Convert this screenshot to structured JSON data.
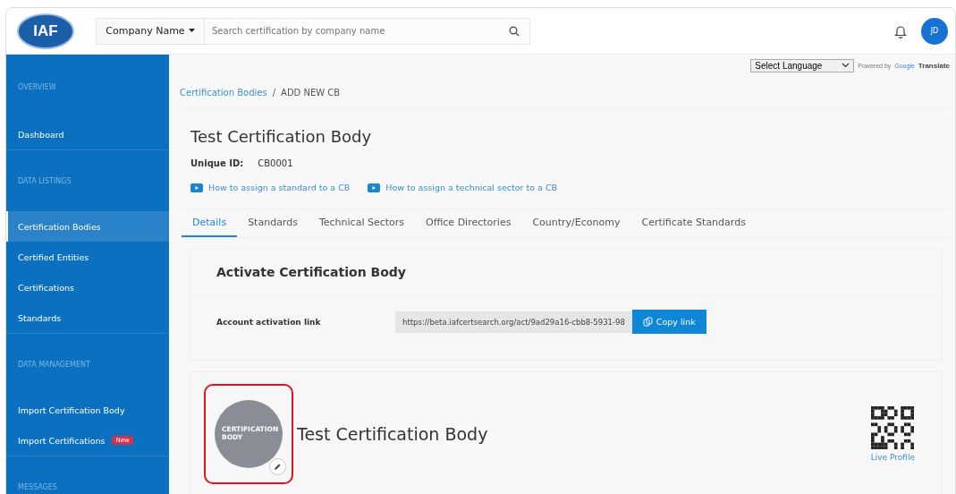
{
  "header": {
    "logo": "IAF",
    "company_dropdown": "Company Name",
    "search": {
      "placeholder": "Search certification by company name"
    },
    "avatar": "JD"
  },
  "sidebar": {
    "items": [
      {
        "kind": "heading",
        "label": "OVERVIEW"
      },
      {
        "kind": "item",
        "label": "Dashboard",
        "selected": false
      },
      {
        "kind": "heading",
        "label": "DATA LISTINGS"
      },
      {
        "kind": "item",
        "label": "Certification Bodies",
        "selected": true
      },
      {
        "kind": "item",
        "label": "Certified Entities",
        "selected": false
      },
      {
        "kind": "item",
        "label": "Certifications",
        "selected": false
      },
      {
        "kind": "item",
        "label": "Standards",
        "selected": false
      },
      {
        "kind": "heading",
        "label": "DATA MANAGEMENT"
      },
      {
        "kind": "item",
        "label": "Import Certification Body",
        "selected": false
      },
      {
        "kind": "item",
        "label": "Import Certifications",
        "selected": false,
        "badge": "New"
      },
      {
        "kind": "heading",
        "label": "MESSAGES"
      }
    ]
  },
  "translate": {
    "select": "Select Language",
    "powered_by": "Powered by",
    "brand": "Google",
    "product": "Translate"
  },
  "breadcrumb": {
    "link": "Certification Bodies",
    "separator": "/",
    "current": "ADD NEW CB"
  },
  "page": {
    "title": "Test Certification Body",
    "unique_id_label": "Unique ID:",
    "unique_id": "CB0001",
    "help_links": [
      "How to assign a standard to a CB",
      "How to assign a technical sector to a CB"
    ]
  },
  "tabs": [
    {
      "label": "Details",
      "selected": true
    },
    {
      "label": "Standards",
      "selected": false
    },
    {
      "label": "Technical Sectors",
      "selected": false
    },
    {
      "label": "Office Directories",
      "selected": false
    },
    {
      "label": "Country/Economy",
      "selected": false
    },
    {
      "label": "Certificate Standards",
      "selected": false
    }
  ],
  "activate": {
    "title": "Activate Certification Body",
    "label": "Account activation link",
    "link": "https://beta.iafcertsearch.org/act/9ad29a16-cbb8-5931-98",
    "button": "Copy link"
  },
  "profile": {
    "avatar_text": "CERTIFICATION BODY",
    "highlighted": true,
    "name": "Test Certification Body",
    "qr_label": "Live Profile"
  }
}
